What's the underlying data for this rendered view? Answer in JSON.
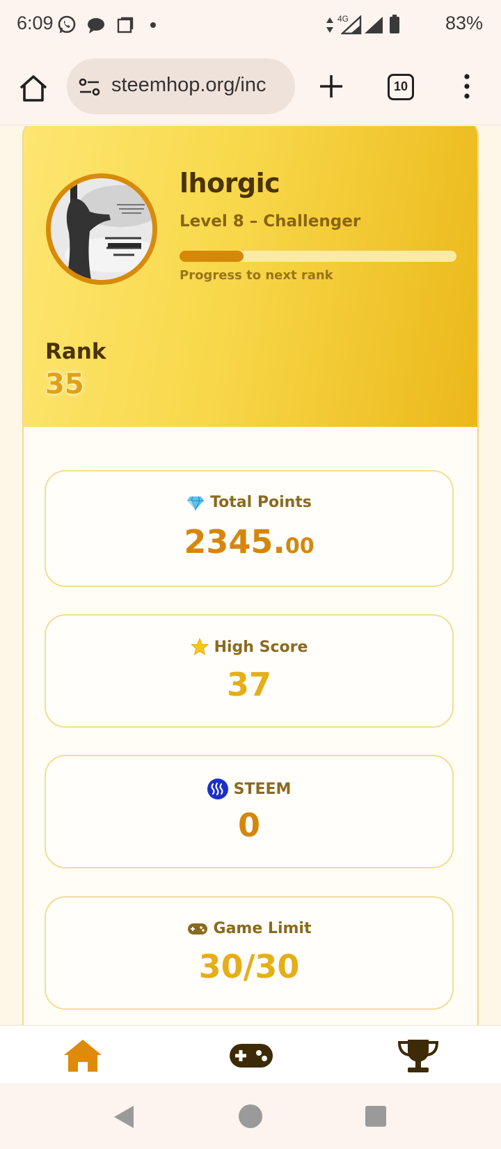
{
  "status_bar": {
    "time": "6:09",
    "network": "4G",
    "battery": "83%",
    "icons": [
      "whatsapp-icon",
      "chat-icon",
      "square-icon",
      "dot-icon",
      "data-arrows-icon",
      "signal-icon",
      "battery-icon"
    ]
  },
  "browser": {
    "url": "steemhop.org/inc",
    "tab_count": "10",
    "icons": [
      "home-icon",
      "site-settings-icon",
      "new-tab-icon",
      "tab-switcher-icon",
      "more-menu-icon"
    ]
  },
  "profile": {
    "username": "lhorgic",
    "level": "Level 8 – Challenger",
    "progress_fraction": 0.23,
    "progress_label": "Progress to next rank",
    "rank_label": "Rank",
    "rank_value": "35"
  },
  "stats": [
    {
      "icon": "diamond-icon",
      "label": "Total Points",
      "value_int": "2345.",
      "value_dec": "00",
      "color": "#d6860c"
    },
    {
      "icon": "star-icon",
      "label": "High Score",
      "value": "37",
      "color": "#e6ae17"
    },
    {
      "icon": "steem-logo-icon",
      "label": "STEEM",
      "value": "0",
      "color": "#d6860c"
    },
    {
      "icon": "gamepad-icon",
      "label": "Game Limit",
      "value": "30/30",
      "color": "#e6ae17"
    }
  ],
  "bottom_nav": {
    "items": [
      "home-icon",
      "gamepad-icon",
      "trophy-icon"
    ],
    "active_color": "#e08a0a",
    "inactive_color": "#3d2a06"
  },
  "colors": {
    "hero_gradient_start": "#fde672",
    "hero_gradient_end": "#ebb81a",
    "avatar_ring": "#d88a0a",
    "steem_blue": "#1a2fc8"
  }
}
